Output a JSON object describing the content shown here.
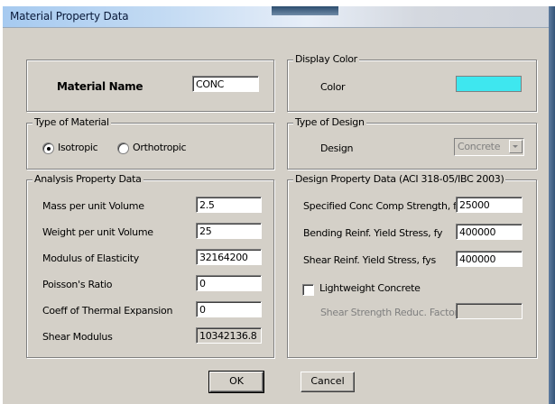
{
  "window": {
    "title": "Material Property Data"
  },
  "material_name": {
    "label": "Material Name",
    "value": "CONC"
  },
  "display_color": {
    "group_label": "Display Color",
    "color_label": "Color",
    "swatch_color": "#3ee7ef"
  },
  "type_of_material": {
    "group_label": "Type of Material",
    "options": [
      {
        "label": "Isotropic",
        "selected": true
      },
      {
        "label": "Orthotropic",
        "selected": false
      }
    ]
  },
  "type_of_design": {
    "group_label": "Type of Design",
    "design_label": "Design",
    "selected": "Concrete"
  },
  "analysis": {
    "group_label": "Analysis Property Data",
    "rows": [
      {
        "label": "Mass per unit Volume",
        "value": "2.5"
      },
      {
        "label": "Weight per unit Volume",
        "value": "25"
      },
      {
        "label": "Modulus of Elasticity",
        "value": "32164200"
      },
      {
        "label": "Poisson's Ratio",
        "value": "0"
      },
      {
        "label": "Coeff of Thermal Expansion",
        "value": "0"
      },
      {
        "label": "Shear Modulus",
        "value": "10342136.8"
      }
    ]
  },
  "design": {
    "group_label": "Design Property Data (ACI 318-05/IBC 2003)",
    "rows": [
      {
        "label": "Specified Conc Comp Strength, f'c",
        "value": "25000"
      },
      {
        "label": "Bending Reinf. Yield Stress, fy",
        "value": "400000"
      },
      {
        "label": "Shear Reinf. Yield Stress, fys",
        "value": "400000"
      }
    ],
    "lightweight_label": "Lightweight Concrete",
    "lightweight_checked": false,
    "shear_factor_label": "Shear Strength Reduc. Factor",
    "shear_factor_value": ""
  },
  "buttons": {
    "ok": "OK",
    "cancel": "Cancel"
  }
}
